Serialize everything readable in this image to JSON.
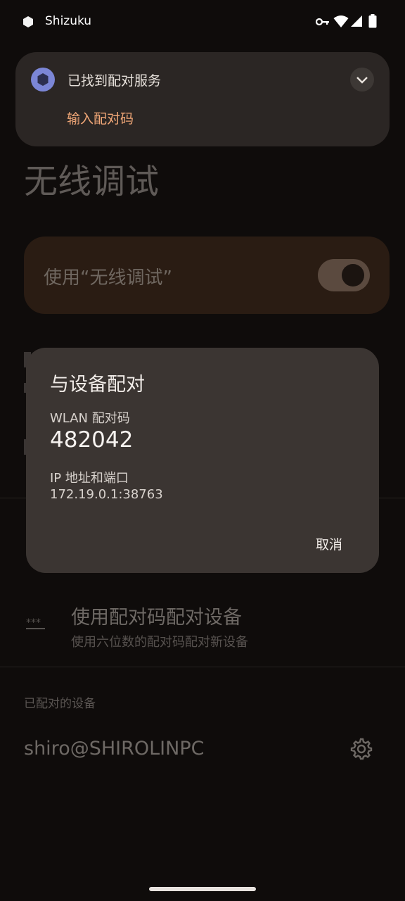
{
  "status_bar": {
    "app_name": "Shizuku",
    "icons": [
      "shizuku-app-icon",
      "vpn-key-icon",
      "wifi-icon",
      "cell-signal-icon",
      "battery-icon"
    ]
  },
  "notification": {
    "title": "已找到配对服务",
    "action": "输入配对码",
    "accent_color": "#f1a777"
  },
  "page": {
    "title": "无线调试",
    "wireless_toggle_label": "使用“无线调试”",
    "wireless_toggle_on": true,
    "pair_with_code_title": "使用配对码配对设备",
    "pair_with_code_summary": "使用六位数的配对码配对新设备",
    "paired_devices_header": "已配对的设备",
    "paired_device_name": "shiro@SHIROLINPC"
  },
  "dialog": {
    "title": "与设备配对",
    "code_label": "WLAN 配对码",
    "code_value": "482042",
    "ip_label": "IP 地址和端口",
    "ip_value": "172.19.0.1:38763",
    "cancel_label": "取消"
  }
}
